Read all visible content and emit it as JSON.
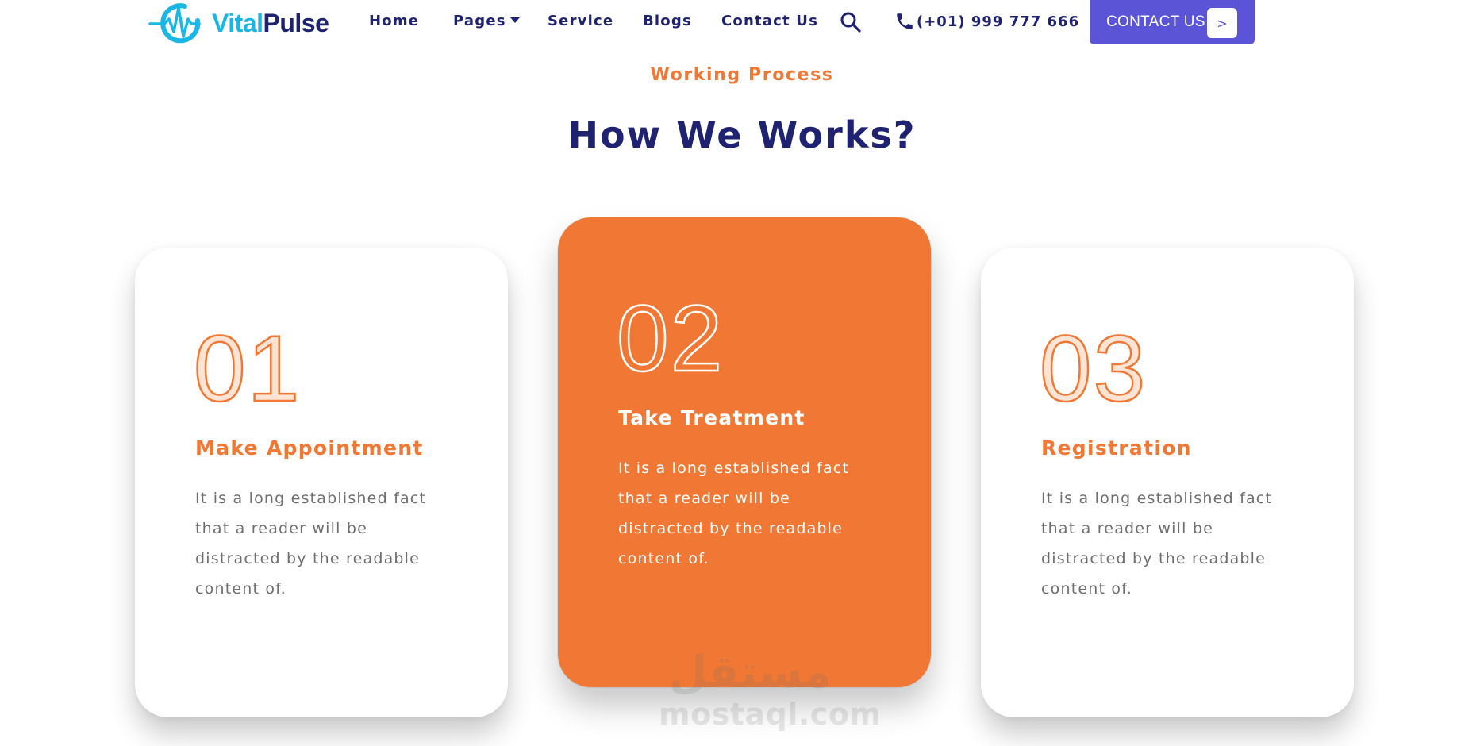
{
  "brand": {
    "name_part1": "Vital",
    "name_part2": "Pulse",
    "primary_color": "#1e2270",
    "accent_color": "#19b6e6",
    "logo_icon": "heartbeat-circle-icon"
  },
  "nav": {
    "links": [
      {
        "label": "Home"
      },
      {
        "label": "Pages",
        "has_dropdown": true
      },
      {
        "label": "Service"
      },
      {
        "label": "Blogs"
      },
      {
        "label": "Contact Us"
      }
    ],
    "search_icon": "search-icon",
    "phone_icon": "phone-icon",
    "phone": "(+01) 999 777 666",
    "cta": {
      "label": "CONTACT US",
      "arrow": ">",
      "color": "#5b54d6"
    }
  },
  "section": {
    "eyebrow": "Working Process",
    "title": "How We Works?",
    "eyebrow_color": "#f07834"
  },
  "cards": [
    {
      "number": "01",
      "title": "Make Appointment",
      "text": "It is a long established fact that a reader will be distracted by the readable content of.",
      "active": false
    },
    {
      "number": "02",
      "title": "Take Treatment",
      "text": "It is a long established fact that a reader will be distracted by the readable content of.",
      "active": true
    },
    {
      "number": "03",
      "title": "Registration",
      "text": "It is a long established fact that a reader will be distracted by the readable content of.",
      "active": false
    }
  ],
  "active_card_color": "#f07834",
  "watermark": {
    "arabic": "مستقل",
    "latin": "mostaql.com"
  }
}
